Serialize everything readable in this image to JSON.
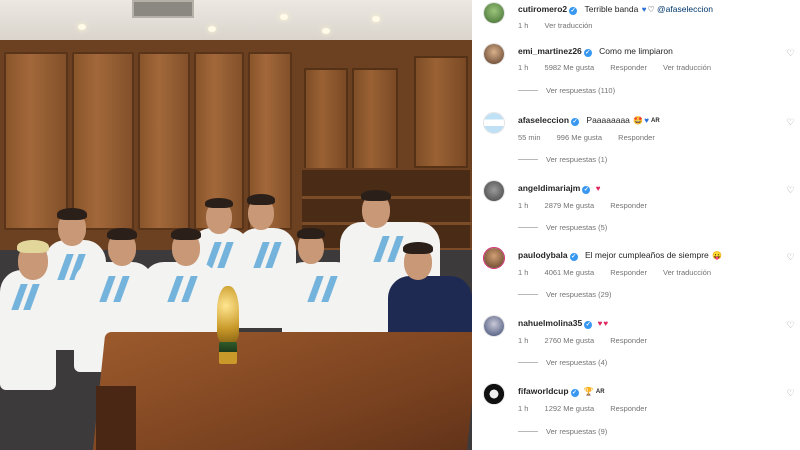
{
  "colors": {
    "verified": "#3897f0",
    "secondary_text": "#737373",
    "heart_red": "#e0245e",
    "heart_blue": "#2b6fd6"
  },
  "photo": {
    "alt": ""
  },
  "comments": [
    {
      "username": "cutiromero2",
      "verified": true,
      "text": "Terrible banda",
      "emojis": [
        "blue-heart-icon",
        "white-heart-icon"
      ],
      "mention": "@afaseleccion",
      "time": "1 h",
      "likes": "",
      "reply_label": "",
      "translate_label": "Ver traducción",
      "replies_label": ""
    },
    {
      "username": "emi_martinez26",
      "verified": true,
      "text": "Como me limpiaron",
      "time": "1 h",
      "likes": "5982 Me gusta",
      "reply_label": "Responder",
      "translate_label": "Ver traducción",
      "replies_label": "Ver respuestas (110)"
    },
    {
      "username": "afaseleccion",
      "verified": true,
      "text": "Paaaaaaaa",
      "emojis": [
        "star-struck-icon",
        "blue-heart-icon"
      ],
      "tag": "AR",
      "time": "55 min",
      "likes": "996 Me gusta",
      "reply_label": "Responder",
      "replies_label": "Ver respuestas (1)"
    },
    {
      "username": "angeldimariajm",
      "verified": true,
      "text": "",
      "emojis": [
        "red-heart-icon"
      ],
      "time": "1 h",
      "likes": "2879 Me gusta",
      "reply_label": "Responder",
      "replies_label": "Ver respuestas (5)"
    },
    {
      "username": "paulodybala",
      "verified": true,
      "text": "El mejor cumpleaños de siempre",
      "emojis": [
        "tongue-face-icon"
      ],
      "time": "1 h",
      "likes": "4061 Me gusta",
      "reply_label": "Responder",
      "translate_label": "Ver traducción",
      "replies_label": "Ver respuestas (29)"
    },
    {
      "username": "nahuelmolina35",
      "verified": true,
      "text": "",
      "emojis": [
        "red-heart-icon",
        "red-heart-icon"
      ],
      "time": "1 h",
      "likes": "2760 Me gusta",
      "reply_label": "Responder",
      "replies_label": "Ver respuestas (4)"
    },
    {
      "username": "fifaworldcup",
      "verified": true,
      "text": "",
      "emojis": [
        "trophy-icon"
      ],
      "tag": "AR",
      "time": "1 h",
      "likes": "1292 Me gusta",
      "reply_label": "Responder",
      "replies_label": "Ver respuestas (9)"
    }
  ]
}
